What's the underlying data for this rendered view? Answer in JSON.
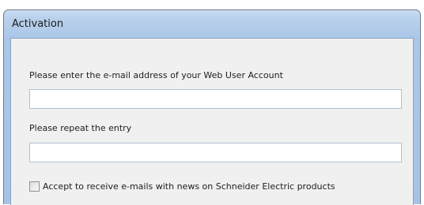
{
  "window": {
    "title": "Activation"
  },
  "form": {
    "email_label": "Please enter the e-mail address of your Web User Account",
    "email_value": "",
    "repeat_label": "Please repeat the entry",
    "repeat_value": "",
    "newsletter_checked": false,
    "newsletter_label": "Accept to receive e-mails with news on Schneider Electric products"
  }
}
